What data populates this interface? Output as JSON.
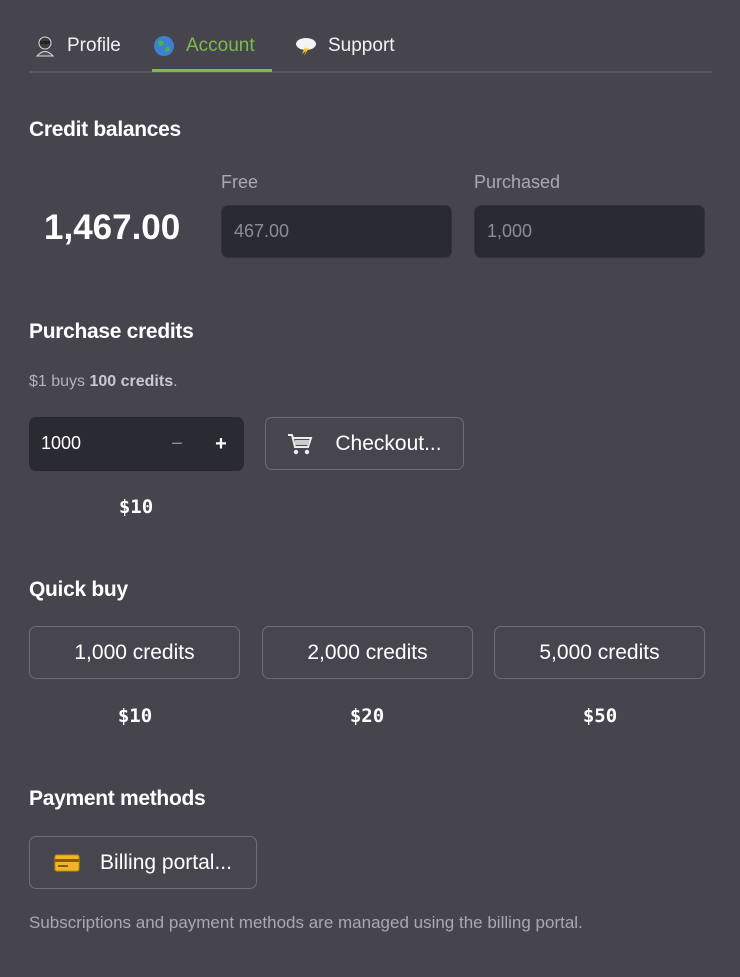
{
  "tabs": [
    {
      "label": "Profile",
      "icon": "user-icon"
    },
    {
      "label": "Account",
      "icon": "globe-icon",
      "active": true
    },
    {
      "label": "Support",
      "icon": "storm-cloud-icon"
    }
  ],
  "accent_color": "#7dbb4a",
  "credit_balances": {
    "heading": "Credit balances",
    "total": "1,467.00",
    "free_label": "Free",
    "free_value": "467.00",
    "purchased_label": "Purchased",
    "purchased_value": "1,000"
  },
  "purchase": {
    "heading": "Purchase credits",
    "note_prefix": "$1 buys ",
    "note_bold": "100 credits",
    "note_suffix": ".",
    "quantity": "1000",
    "minus": "−",
    "plus": "+",
    "checkout_label": "Checkout...",
    "checkout_icon": "shopping-cart-icon",
    "price": "$10"
  },
  "quick_buy": {
    "heading": "Quick buy",
    "options": [
      {
        "label": "1,000 credits",
        "price": "$10"
      },
      {
        "label": "2,000 credits",
        "price": "$20"
      },
      {
        "label": "5,000 credits",
        "price": "$50"
      }
    ]
  },
  "payment_methods": {
    "heading": "Payment methods",
    "billing_label": "Billing portal...",
    "billing_icon": "credit-card-icon",
    "note": "Subscriptions and payment methods are managed using the billing portal."
  }
}
